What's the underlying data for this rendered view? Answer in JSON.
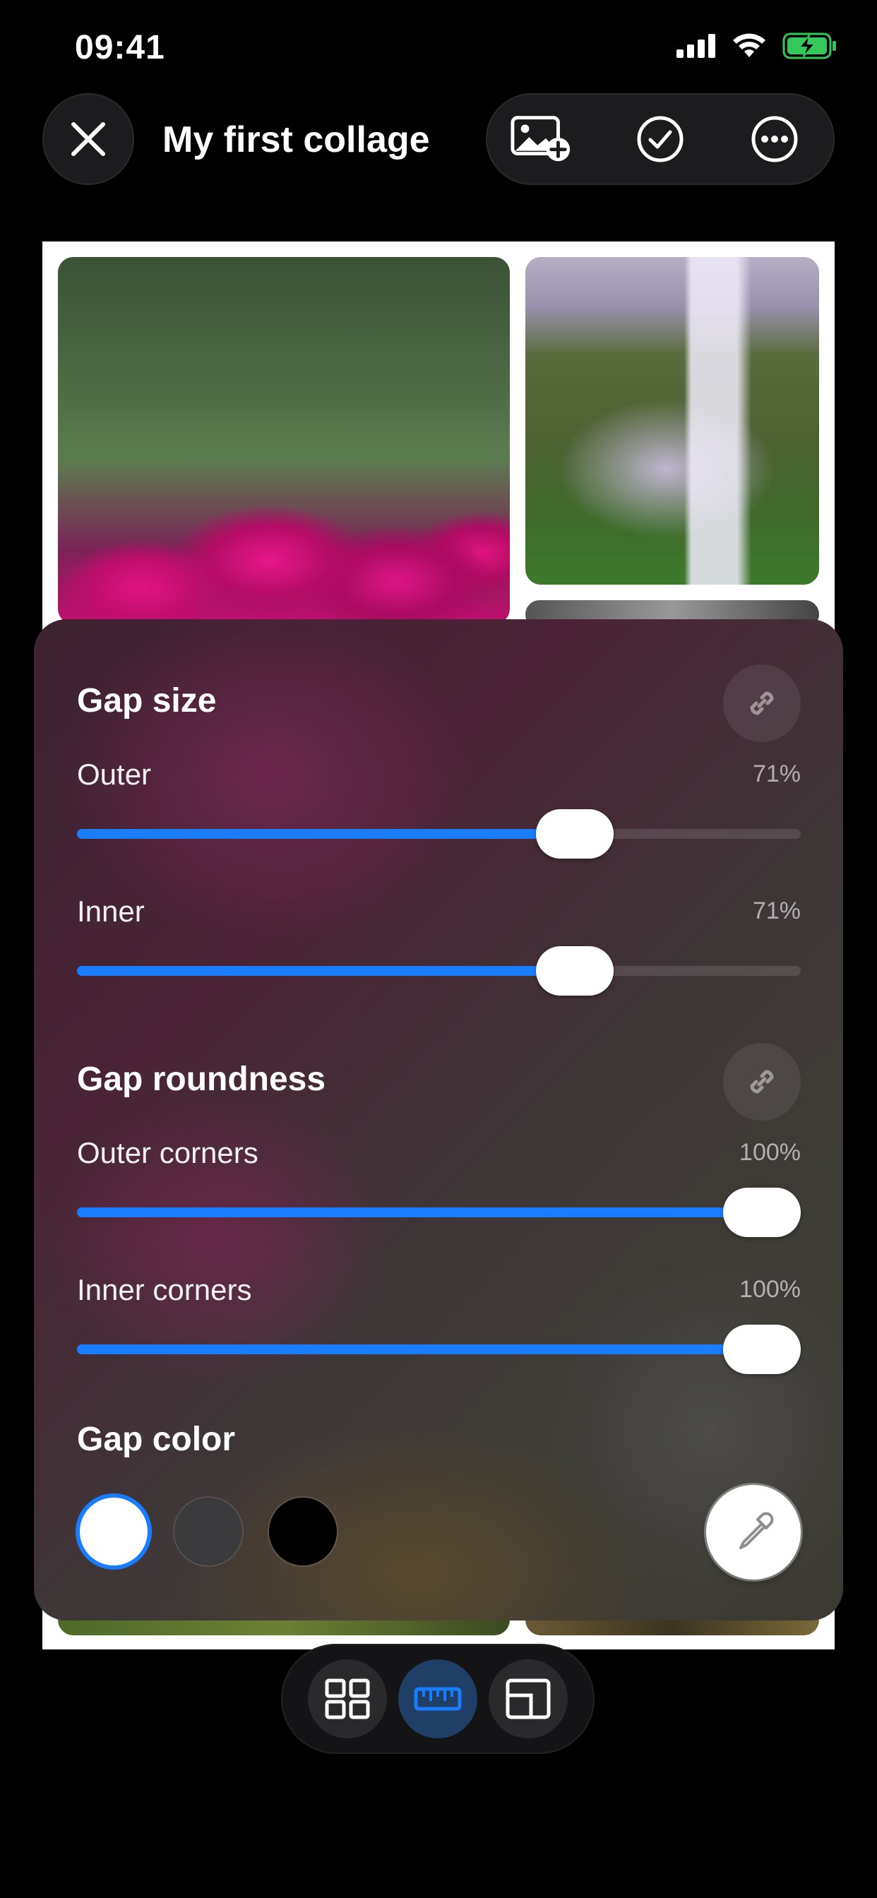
{
  "status": {
    "time": "09:41"
  },
  "header": {
    "title": "My first collage"
  },
  "icons": {
    "close": "close-icon",
    "add_photo": "add-photo-icon",
    "confirm": "checkmark-circle-icon",
    "more": "more-options-icon",
    "link": "link-icon",
    "eyedropper": "eyedropper-icon",
    "layout": "grid-layout-icon",
    "spacing": "ruler-icon",
    "ratio": "aspect-ratio-icon"
  },
  "panel": {
    "gap_size": {
      "title": "Gap size",
      "outer": {
        "label": "Outer",
        "value_text": "71%",
        "value": 0.71
      },
      "inner": {
        "label": "Inner",
        "value_text": "71%",
        "value": 0.71
      }
    },
    "gap_roundness": {
      "title": "Gap roundness",
      "outer": {
        "label": "Outer corners",
        "value_text": "100%",
        "value": 1.0
      },
      "inner": {
        "label": "Inner corners",
        "value_text": "100%",
        "value": 1.0
      }
    },
    "gap_color": {
      "title": "Gap color",
      "swatches": [
        "#ffffff",
        "#3a3a3c",
        "#000000"
      ],
      "selected_index": 0
    }
  },
  "colors": {
    "accent": "#1a7cff",
    "background": "#000000"
  },
  "bottom_bar": {
    "active_index": 1
  }
}
